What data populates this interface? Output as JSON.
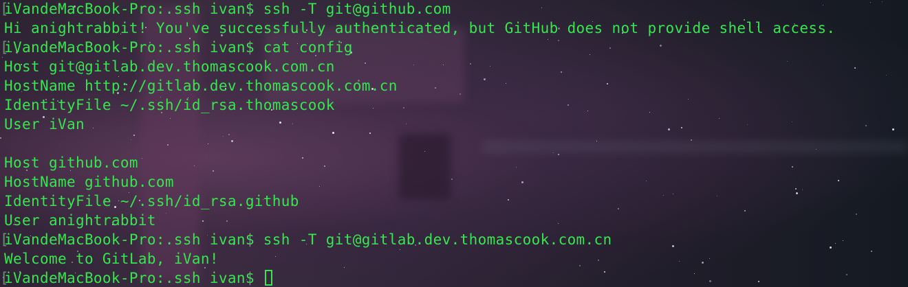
{
  "terminal": {
    "lines": [
      {
        "prompt": true,
        "text": "iVandeMacBook-Pro:.ssh ivan$ ssh -T git@github.com"
      },
      {
        "prompt": false,
        "text": "Hi anightrabbit! You've successfully authenticated, but GitHub does not provide shell access."
      },
      {
        "prompt": true,
        "text": "iVandeMacBook-Pro:.ssh ivan$ cat config"
      },
      {
        "prompt": false,
        "text": "Host git@gitlab.dev.thomascook.com.cn"
      },
      {
        "prompt": false,
        "text": "HostName http://gitlab.dev.thomascook.com.cn"
      },
      {
        "prompt": false,
        "text": "IdentityFile ~/.ssh/id_rsa.thomascook"
      },
      {
        "prompt": false,
        "text": "User iVan"
      },
      {
        "prompt": false,
        "text": ""
      },
      {
        "prompt": false,
        "text": "Host github.com"
      },
      {
        "prompt": false,
        "text": "HostName github.com"
      },
      {
        "prompt": false,
        "text": "IdentityFile ~/.ssh/id_rsa.github"
      },
      {
        "prompt": false,
        "text": "User anightrabbit"
      },
      {
        "prompt": true,
        "text": "iVandeMacBook-Pro:.ssh ivan$ ssh -T git@gitlab.dev.thomascook.com.cn"
      },
      {
        "prompt": false,
        "text": "Welcome to GitLab, iVan!"
      },
      {
        "prompt": true,
        "text": "iVandeMacBook-Pro:.ssh ivan$ ",
        "cursor": true
      }
    ],
    "text_color": "#36e64e",
    "bracket_glyph": "["
  }
}
